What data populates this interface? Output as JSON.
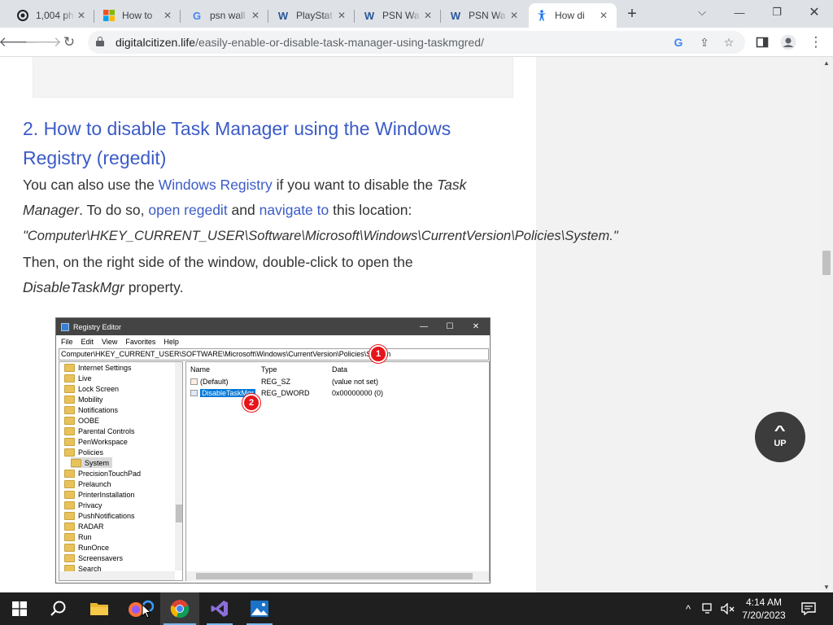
{
  "browser": {
    "tabs": [
      {
        "title": "1,004 ph",
        "favicon": "spiral-icon"
      },
      {
        "title": "How to",
        "favicon": "microsoft-icon"
      },
      {
        "title": "psn wall",
        "favicon": "google-icon"
      },
      {
        "title": "PlayStat",
        "favicon": "wordpress-icon"
      },
      {
        "title": "PSN Wa",
        "favicon": "wordpress-icon"
      },
      {
        "title": "PSN Wa",
        "favicon": "wordpress-icon"
      },
      {
        "title": "How di",
        "favicon": "accessibility-icon"
      }
    ],
    "url_host": "digitalcitizen.life",
    "url_path": "/easily-enable-or-disable-task-manager-using-taskmgred/"
  },
  "article": {
    "heading": "2. How to disable Task Manager using the Windows Registry (regedit)",
    "p1_a": "You can also use the ",
    "p1_link": "Windows Registry",
    "p1_b": " if you want to disable the ",
    "p1_em1": "Task",
    "p2_em": "Manager",
    "p2_a": ". To do so, ",
    "p2_link1": "open regedit",
    "p2_b": " and ",
    "p2_link2": "navigate to",
    "p2_c": " this location:",
    "p3_quote": "\"Computer\\HKEY_CURRENT_USER\\Software\\Microsoft\\Windows\\CurrentVersion\\Policies\\System.\"",
    "p4": "Then, on the right side of the window, double-click to open the",
    "p5_em": "DisableTaskMgr",
    "p5_b": " property."
  },
  "regedit": {
    "title": "Registry Editor",
    "menu": [
      "File",
      "Edit",
      "View",
      "Favorites",
      "Help"
    ],
    "address": "Computer\\HKEY_CURRENT_USER\\SOFTWARE\\Microsoft\\Windows\\CurrentVersion\\Policies\\System",
    "tree": [
      "Internet Settings",
      "Live",
      "Lock Screen",
      "Mobility",
      "Notifications",
      "OOBE",
      "Parental Controls",
      "PenWorkspace",
      "Policies",
      "System",
      "PrecisionTouchPad",
      "Prelaunch",
      "PrinterInstallation",
      "Privacy",
      "PushNotifications",
      "RADAR",
      "Run",
      "RunOnce",
      "Screensavers",
      "Search"
    ],
    "columns": [
      "Name",
      "Type",
      "Data"
    ],
    "rows": [
      {
        "name": "(Default)",
        "type": "REG_SZ",
        "data": "(value not set)"
      },
      {
        "name": "DisableTaskMgr",
        "type": "REG_DWORD",
        "data": "0x00000000 (0)"
      }
    ],
    "badges": [
      "1",
      "2"
    ]
  },
  "up_button": "UP",
  "taskbar": {
    "time": "4:14 AM",
    "date": "7/20/2023"
  },
  "colors": {
    "link": "#3b5bc7",
    "heading": "#3b5bc7",
    "badge": "#e8141b",
    "taskbar": "#1f1f1f"
  }
}
